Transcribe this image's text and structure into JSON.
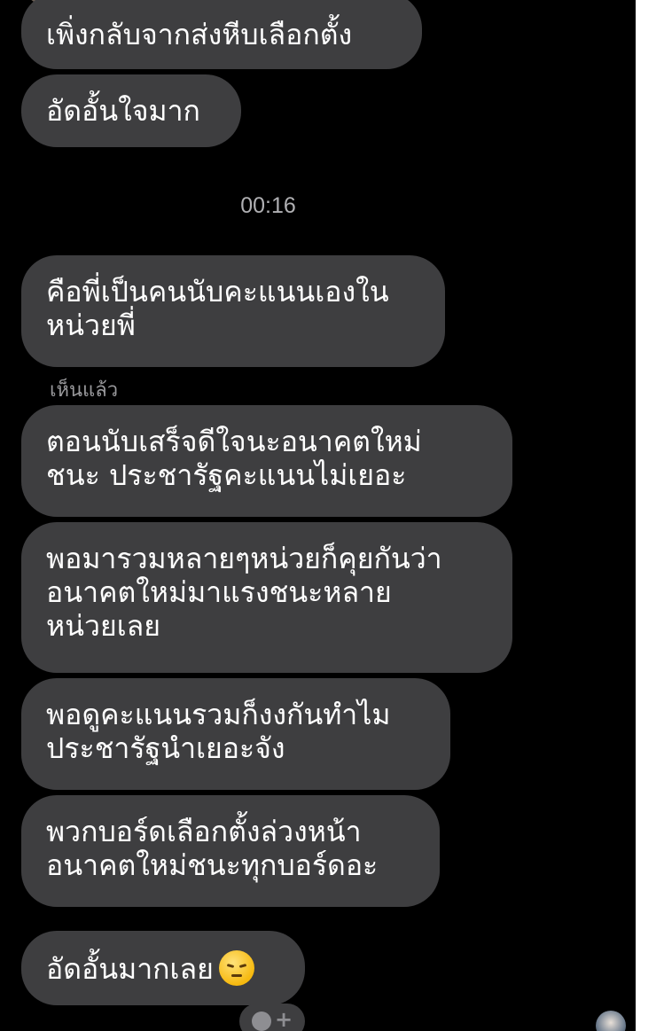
{
  "messages": [
    {
      "lines": [
        "เพิ่งกลับจากส่งหีบเลือกตั้ง"
      ]
    },
    {
      "lines": [
        "อัดอั้นใจมาก"
      ]
    },
    {
      "lines": [
        "คือพี่เป็นคนนับคะแนนเองใน",
        "หน่วยพี่"
      ]
    },
    {
      "lines": [
        "ตอนนับเสร็จดีใจนะอนาคตใหม่",
        "ชนะ ประชารัฐคะแนนไม่เยอะ"
      ]
    },
    {
      "lines": [
        "พอมารวมหลายๆหน่วยก็คุยกันว่า",
        "อนาคตใหม่มาแรงชนะหลาย",
        "หน่วยเลย"
      ]
    },
    {
      "lines": [
        "พอดูคะแนนรวมก็งงกันทำไม",
        "ประชารัฐนำเยอะจัง"
      ]
    },
    {
      "lines": [
        "พวกบอร์ดเลือกตั้งล่วงหน้า",
        "อนาคตใหม่ชนะทุกบอร์ดอะ"
      ]
    },
    {
      "lines": [
        "อัดอั้นมากเลย"
      ],
      "emoji": "disappointed-face-icon"
    }
  ],
  "timestamp": "00:16",
  "seen_label": "เห็นแล้ว",
  "react_button_plus": "+",
  "colors": {
    "background": "#000000",
    "bubble": "#3e3e40",
    "text": "#ffffff",
    "meta_text": "#b0b0b3"
  }
}
